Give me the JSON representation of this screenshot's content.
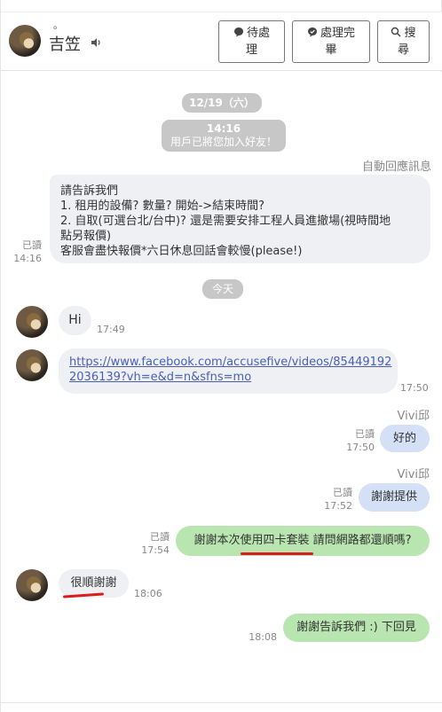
{
  "header": {
    "dot": "。",
    "contact_name": "吉笠",
    "btn_pending_line1": "待處",
    "btn_pending_line2": "理",
    "btn_done_line1": "處理完",
    "btn_done_line2": "畢",
    "btn_search_line1": "搜",
    "btn_search_line2": "尋"
  },
  "chat": {
    "date_divider": "12/19（六）",
    "system_time": "14:16",
    "system_text": "用戶已將您加入好友！",
    "auto_reply_label": "自動回應訊息",
    "auto_reply_lines": [
      "請告訴我們",
      "1. 租用的設備? 數量? 開始->結束時間?",
      "2. 自取(可選台北/台中)? 還是需要安排工程人員進撤場(視時間地",
      "點另報價)",
      "客服會盡快報價*六日休息回話會較慢(please!)"
    ],
    "auto_reply_read": "已讀",
    "auto_reply_time": "14:16",
    "today_divider": "今天",
    "messages": [
      {
        "text": "Hi",
        "time": "17:49"
      },
      {
        "text_line1": "https://www.facebook.com/accusefive/videos/85449192",
        "text_line2": "2036139?vh=e&d=n&sfns=mo",
        "time": "17:50"
      },
      {
        "sender": "Vivi邱",
        "text": "好的",
        "read": "已讀",
        "time": "17:50"
      },
      {
        "sender": "Vivi邱",
        "text": "謝謝提供",
        "read": "已讀",
        "time": "17:52"
      },
      {
        "text": "謝謝本次使用四卡套裝 請問網路都還順嗎?",
        "read": "已讀",
        "time": "17:54"
      },
      {
        "text": "很順謝謝",
        "time": "18:06"
      },
      {
        "text": "謝謝告訴我們 :) 下回見",
        "time": "18:08"
      }
    ]
  },
  "colors": {
    "grey_bubble": "#eef0f3",
    "blue_bubble": "#d4e0f5",
    "green_bubble": "#b9e6b0",
    "annotation_red": "#d81e1e"
  }
}
